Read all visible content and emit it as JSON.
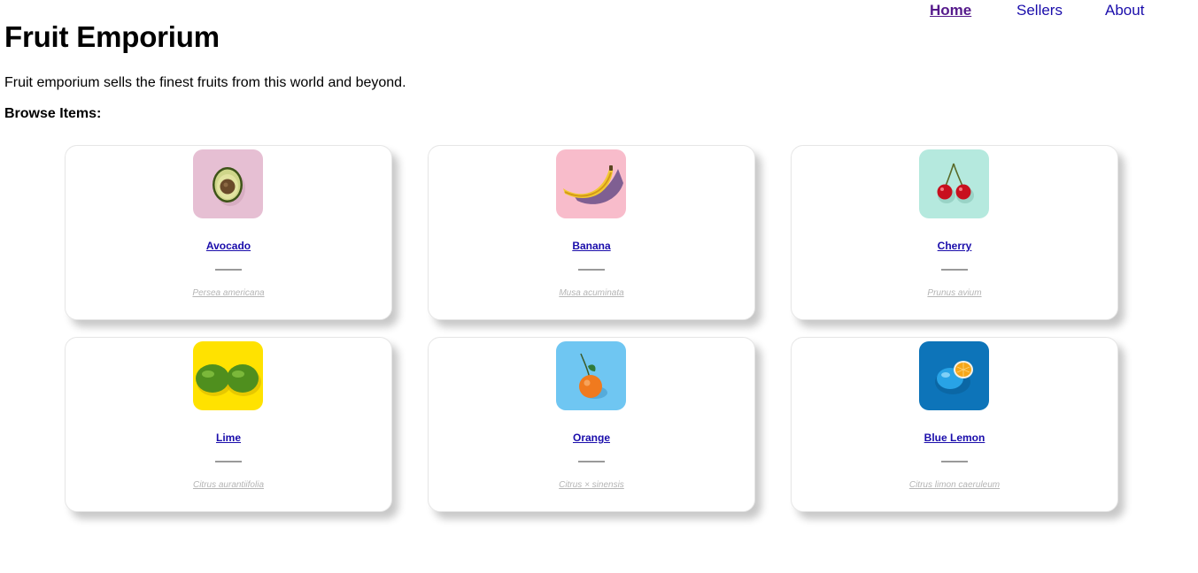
{
  "nav": {
    "home": "Home",
    "sellers": "Sellers",
    "about": "About"
  },
  "page": {
    "title": "Fruit Emporium",
    "description": "Fruit emporium sells the finest fruits from this world and beyond.",
    "browse_label": "Browse Items:"
  },
  "colors": {
    "link": "#1a0dab",
    "visited_link": "#551a8b",
    "scientific_name": "#b5b5b5"
  },
  "items": [
    {
      "name": "Avocado",
      "scientific": "Persea americana",
      "icon": "avocado-image",
      "bg": "#e6bfd3"
    },
    {
      "name": "Banana",
      "scientific": "Musa acuminata",
      "icon": "banana-image",
      "bg": "#f8bccb"
    },
    {
      "name": "Cherry",
      "scientific": "Prunus avium",
      "icon": "cherry-image",
      "bg": "#b5e9de"
    },
    {
      "name": "Lime",
      "scientific": "Citrus aurantiifolia",
      "icon": "lime-image",
      "bg": "#ffe200"
    },
    {
      "name": "Orange",
      "scientific": "Citrus × sinensis",
      "icon": "orange-image",
      "bg": "#6fc6f2"
    },
    {
      "name": "Blue Lemon",
      "scientific": "Citrus limon caeruleum",
      "icon": "blue-lemon-image",
      "bg": "#0d74b9"
    }
  ]
}
